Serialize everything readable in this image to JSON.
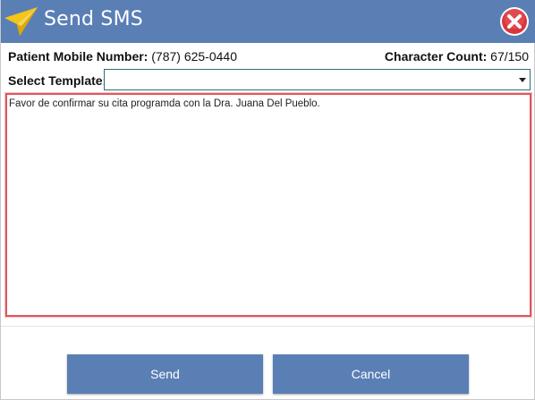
{
  "window": {
    "title": "Send SMS"
  },
  "icons": {
    "app_icon": "paper-plane-icon",
    "close_icon": "close-icon"
  },
  "patient": {
    "label": "Patient Mobile Number:",
    "value": "(787) 625-0440"
  },
  "character_count": {
    "label": "Character Count:",
    "value": "67/150"
  },
  "template": {
    "label": "Select Template:",
    "selected": ""
  },
  "message": {
    "text": "Favor de confirmar su cita programda con la Dra. Juana Del Pueblo."
  },
  "buttons": {
    "send": "Send",
    "cancel": "Cancel"
  },
  "colors": {
    "titlebar": "#5a7fb5",
    "button": "#5a7fb5",
    "highlight_border": "#e0575e",
    "close_red": "#d9363e"
  }
}
